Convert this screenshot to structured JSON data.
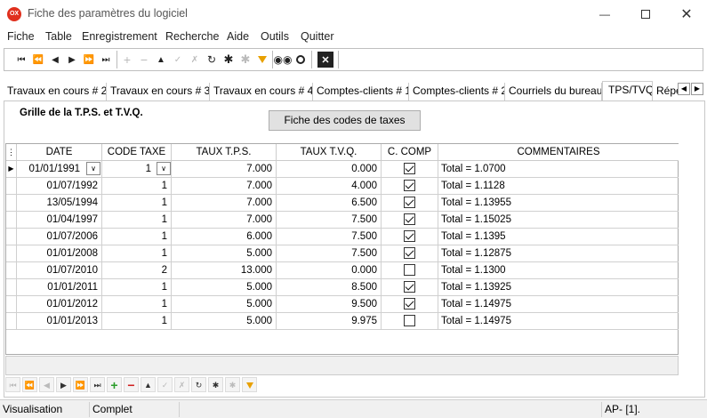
{
  "window": {
    "title": "Fiche des paramètres du logiciel",
    "app_icon_text": "OX"
  },
  "menu": [
    "Fiche",
    "Table",
    "Enregistrement",
    "Recherche",
    "Aide",
    "Outils",
    "Quitter"
  ],
  "tabs": [
    "Travaux en cours # 2",
    "Travaux en cours # 3",
    "Travaux en cours # 4",
    "Comptes-clients # 1",
    "Comptes-clients # 2",
    "Courriels du bureau",
    "TPS/TVQ",
    "Répe"
  ],
  "active_tab": "TPS/TVQ",
  "panel": {
    "group_title": "Grille de la T.P.S. et T.V.Q.",
    "taxes_button": "Fiche des codes de taxes"
  },
  "grid": {
    "headers": [
      "DATE",
      "CODE TAXE",
      "TAUX T.P.S.",
      "TAUX T.V.Q.",
      "C. COMP",
      "COMMENTAIRES"
    ],
    "rows": [
      {
        "date": "01/01/1991",
        "code": "1",
        "tps": "7.000",
        "tvq": "0.000",
        "comp": true,
        "comment": "Total = 1.0700"
      },
      {
        "date": "01/07/1992",
        "code": "1",
        "tps": "7.000",
        "tvq": "4.000",
        "comp": true,
        "comment": "Total = 1.1128"
      },
      {
        "date": "13/05/1994",
        "code": "1",
        "tps": "7.000",
        "tvq": "6.500",
        "comp": true,
        "comment": "Total = 1.13955"
      },
      {
        "date": "01/04/1997",
        "code": "1",
        "tps": "7.000",
        "tvq": "7.500",
        "comp": true,
        "comment": "Total = 1.15025"
      },
      {
        "date": "01/07/2006",
        "code": "1",
        "tps": "6.000",
        "tvq": "7.500",
        "comp": true,
        "comment": "Total = 1.1395"
      },
      {
        "date": "01/01/2008",
        "code": "1",
        "tps": "5.000",
        "tvq": "7.500",
        "comp": true,
        "comment": "Total = 1.12875"
      },
      {
        "date": "01/07/2010",
        "code": "2",
        "tps": "13.000",
        "tvq": "0.000",
        "comp": false,
        "comment": "Total = 1.1300"
      },
      {
        "date": "01/01/2011",
        "code": "1",
        "tps": "5.000",
        "tvq": "8.500",
        "comp": true,
        "comment": "Total = 1.13925"
      },
      {
        "date": "01/01/2012",
        "code": "1",
        "tps": "5.000",
        "tvq": "9.500",
        "comp": true,
        "comment": "Total = 1.14975"
      },
      {
        "date": "01/01/2013",
        "code": "1",
        "tps": "5.000",
        "tvq": "9.975",
        "comp": false,
        "comment": "Total = 1.14975"
      }
    ]
  },
  "status": {
    "mode": "Visualisation",
    "state": "Complet",
    "right": "AP- [1]."
  },
  "colors": {
    "app_icon": "#e0301e",
    "filter_icon": "#e8a000",
    "add_icon": "#2a9d2a",
    "delete_icon": "#d02020"
  }
}
